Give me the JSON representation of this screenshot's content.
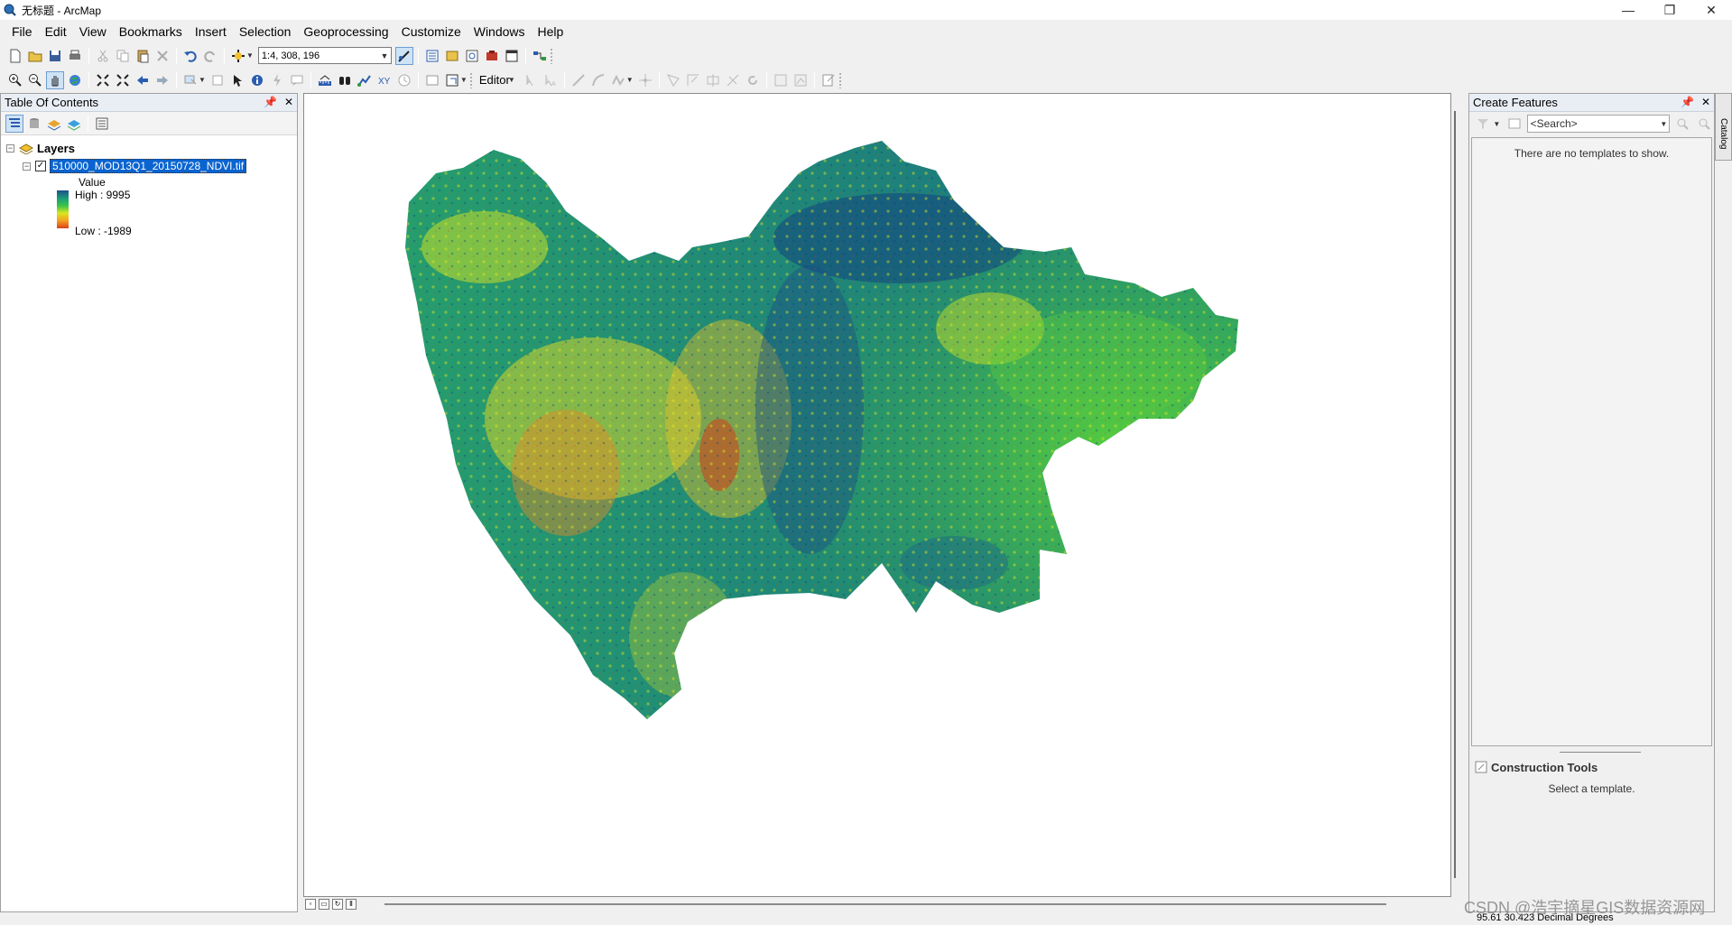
{
  "window": {
    "title": "无标题 - ArcMap",
    "minimize": "—",
    "restore": "❐",
    "close": "✕"
  },
  "menu": [
    "File",
    "Edit",
    "View",
    "Bookmarks",
    "Insert",
    "Selection",
    "Geoprocessing",
    "Customize",
    "Windows",
    "Help"
  ],
  "toolbar": {
    "scale": "1:4, 308, 196",
    "editor_label": "Editor"
  },
  "toc": {
    "title": "Table Of Contents",
    "root_label": "Layers",
    "layer_name": "510000_MOD13Q1_20150728_NDVI.tif",
    "legend_field": "Value",
    "legend_high": "High : 9995",
    "legend_low": "Low : -1989",
    "ramp_colors": [
      "#1f4f8a",
      "#1a9a7a",
      "#39c24a",
      "#d9e81e",
      "#f5a020",
      "#d9401a"
    ]
  },
  "create_features": {
    "title": "Create Features",
    "search_placeholder": "<Search>",
    "empty_message": "There are no templates to show.",
    "construction_title": "Construction Tools",
    "construction_message": "Select a template."
  },
  "catalog_tab": "Catalog",
  "status": {
    "coordinates": "95.61  30.423 Decimal Degrees"
  },
  "watermark": "CSDN @浩宇摘星GIS数据资源网"
}
